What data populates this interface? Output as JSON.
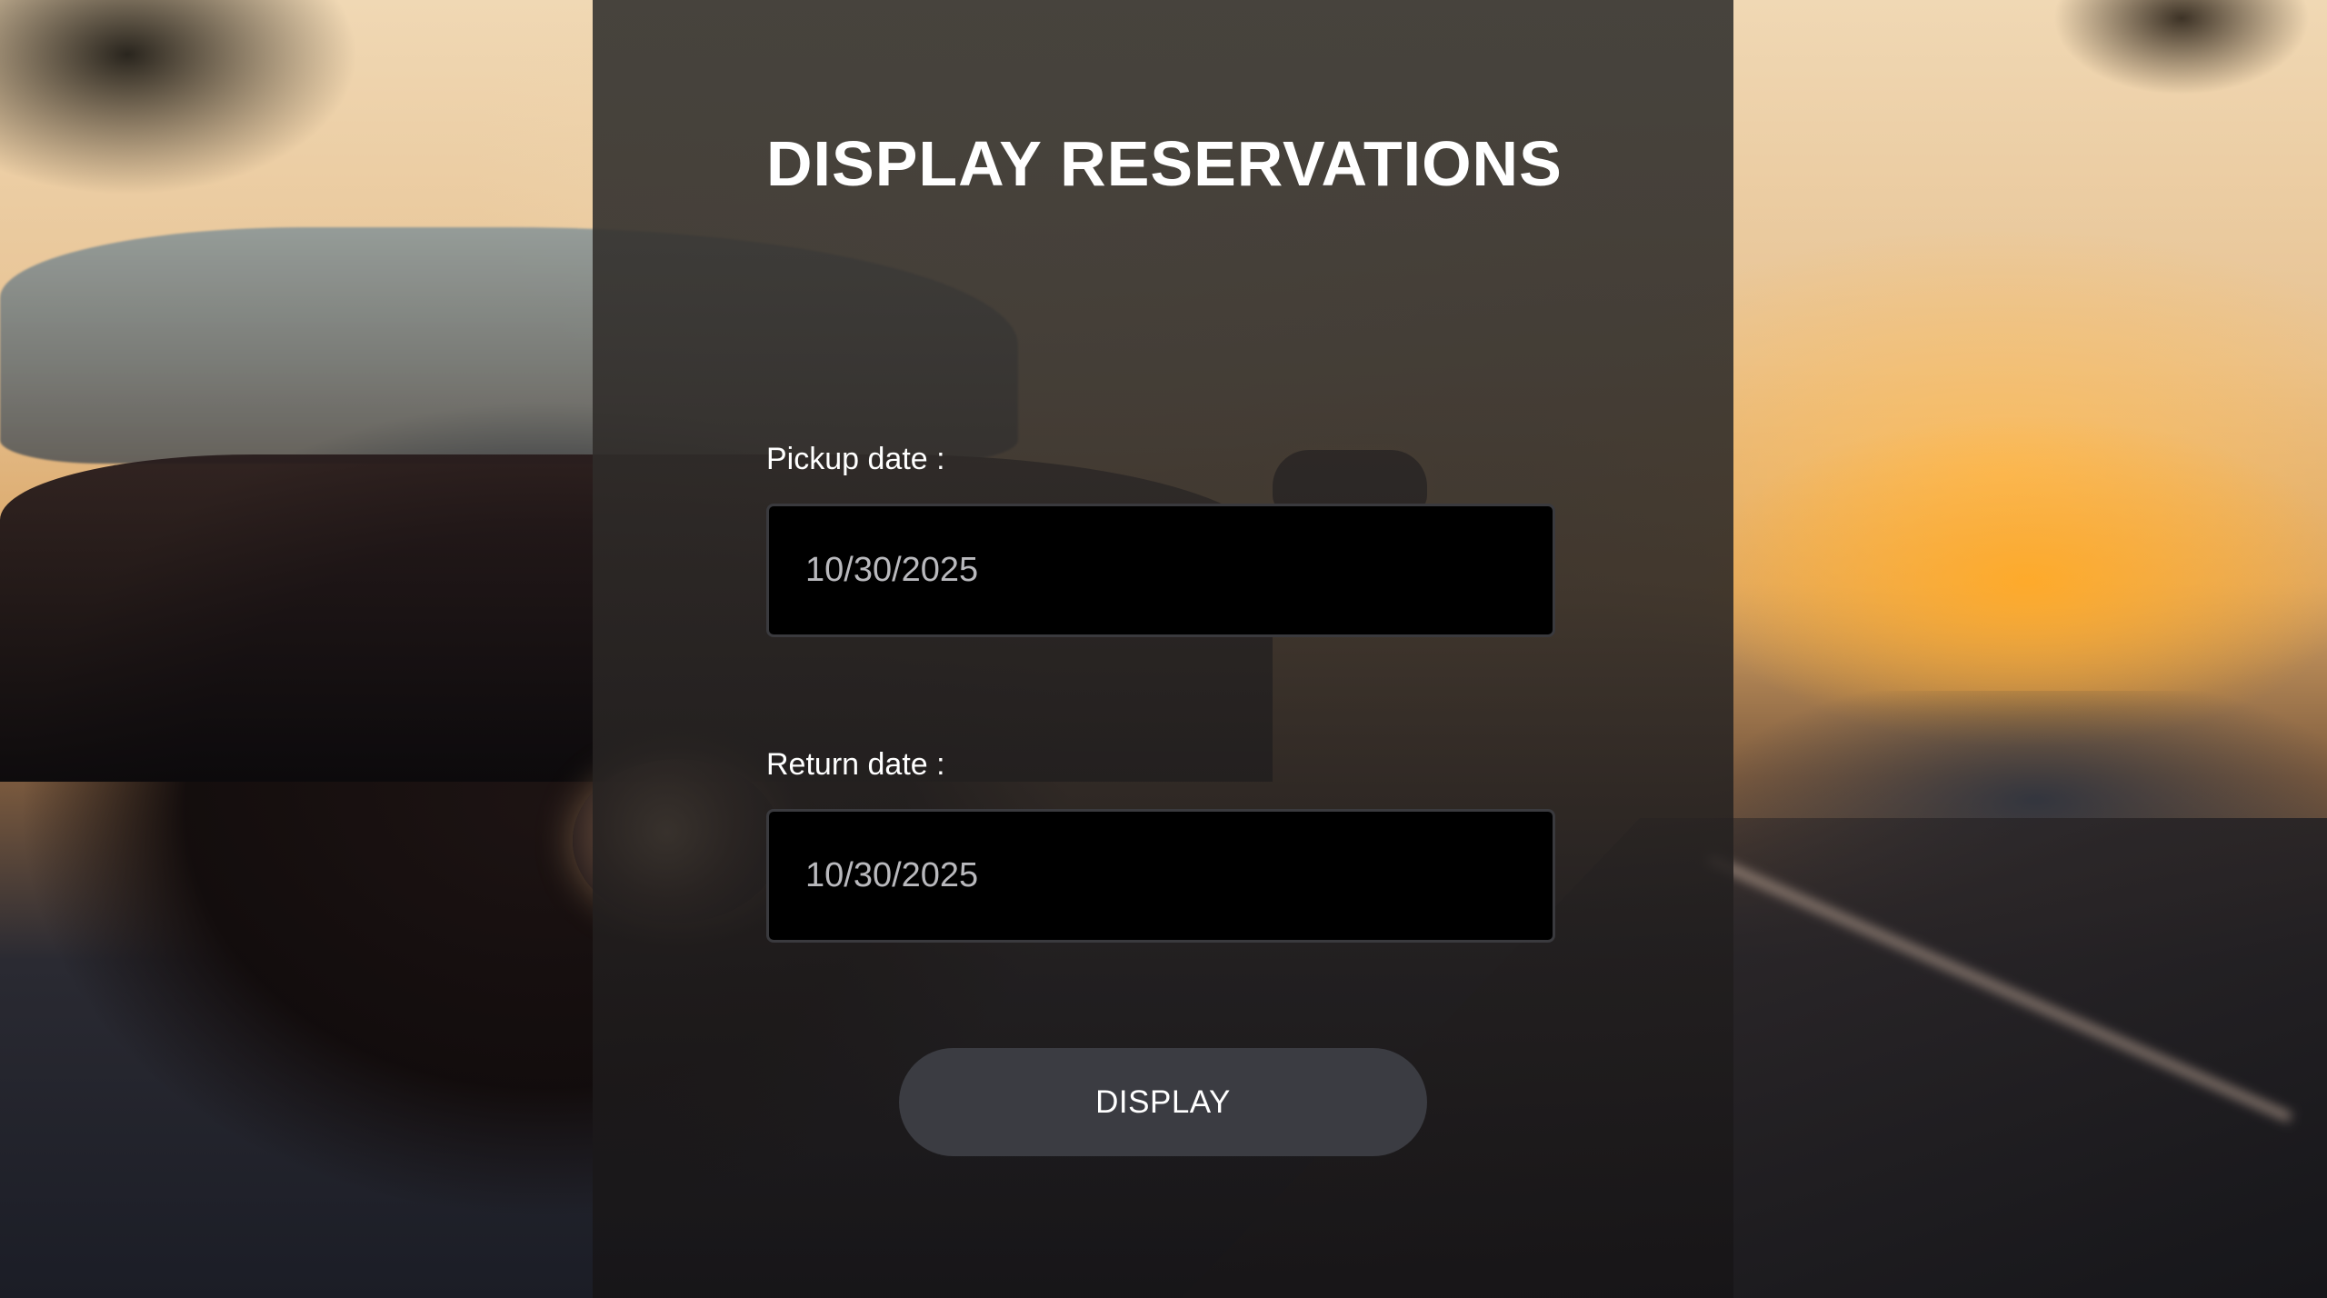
{
  "page": {
    "title": "DISPLAY RESERVATIONS"
  },
  "form": {
    "pickup": {
      "label": "Pickup date :",
      "value": "10/30/2025"
    },
    "return": {
      "label": "Return date :",
      "value": "10/30/2025"
    },
    "submit_label": "DISPLAY"
  },
  "colors": {
    "panel_overlay": "#2c2a28",
    "input_background": "#000000",
    "input_border": "#3a3a3e",
    "button_background": "#3b3c42",
    "text": "#ffffff"
  }
}
